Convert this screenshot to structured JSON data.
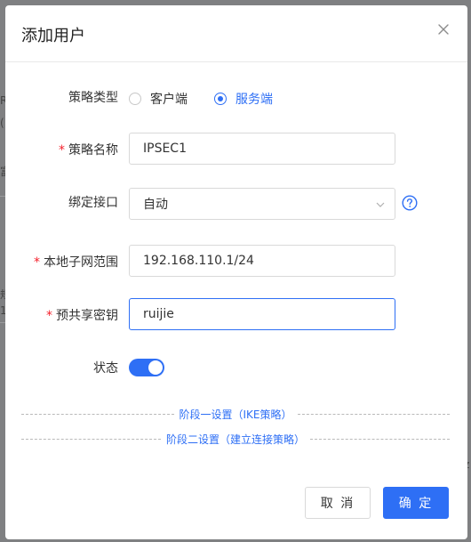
{
  "background": {
    "fragments": [
      "Ri",
      "(",
      "富",
      "规",
      "1",
      "z"
    ]
  },
  "dialog": {
    "title": "添加用户",
    "close_label": "close"
  },
  "form": {
    "policy_type": {
      "label": "策略类型",
      "options": [
        "客户端",
        "服务端"
      ],
      "selected": "服务端"
    },
    "policy_name": {
      "required_mark": "*",
      "label": "策略名称",
      "value": "IPSEC1"
    },
    "bind_interface": {
      "label": "绑定接口",
      "value": "自动"
    },
    "local_subnet": {
      "required_mark": "*",
      "label": "本地子网范围",
      "value": "192.168.110.1/24"
    },
    "psk": {
      "required_mark": "*",
      "label": "预共享密钥",
      "value": "ruijie"
    },
    "status": {
      "label": "状态",
      "enabled": true
    }
  },
  "sections": {
    "phase1": "阶段一设置（IKE策略）",
    "phase2": "阶段二设置（建立连接策略）"
  },
  "buttons": {
    "cancel": "取 消",
    "ok": "确 定"
  },
  "colors": {
    "accent": "#2e6ff5",
    "required": "#f5222d",
    "overlay": "#7f8082"
  }
}
